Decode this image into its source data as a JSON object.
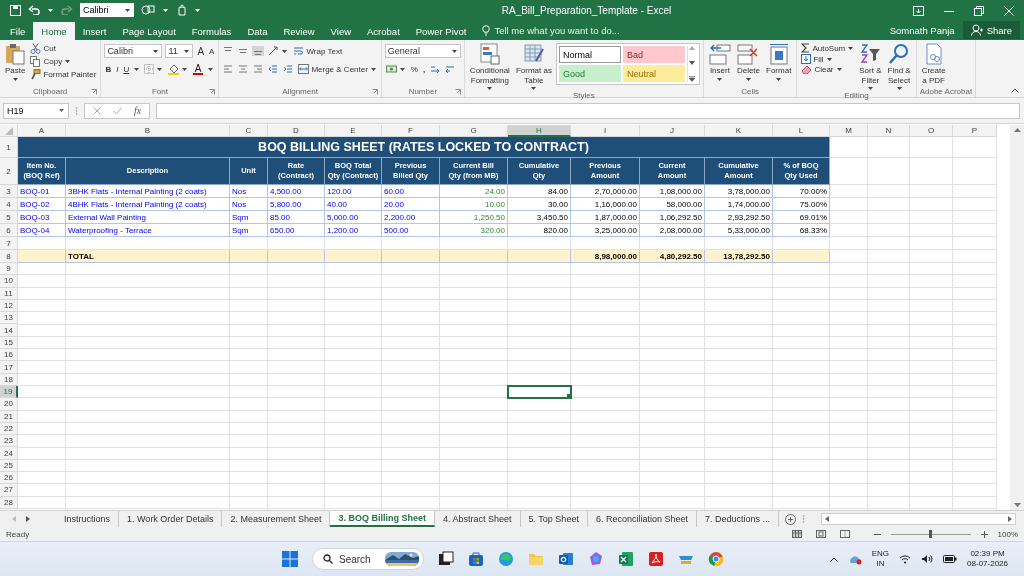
{
  "title_bar": {
    "font_box": "Calibri",
    "title": "RA_Bill_Preparation_Template - Excel"
  },
  "ribbon_tabs": [
    {
      "label": "File",
      "selected": false
    },
    {
      "label": "Home",
      "selected": true
    },
    {
      "label": "Insert",
      "selected": false
    },
    {
      "label": "Page Layout",
      "selected": false
    },
    {
      "label": "Formulas",
      "selected": false
    },
    {
      "label": "Data",
      "selected": false
    },
    {
      "label": "Review",
      "selected": false
    },
    {
      "label": "View",
      "selected": false
    },
    {
      "label": "Acrobat",
      "selected": false
    },
    {
      "label": "Power Pivot",
      "selected": false
    }
  ],
  "tell_me": "Tell me what you want to do...",
  "user": "Somnath Panja",
  "share": "Share",
  "ribbon": {
    "clipboard": {
      "paste": "Paste",
      "cut": "Cut",
      "copy": "Copy",
      "format_painter": "Format Painter",
      "label": "Clipboard"
    },
    "font": {
      "font_name": "Calibri",
      "font_size": "11",
      "grow": "A",
      "shrink": "A",
      "bold": "B",
      "italic": "I",
      "underline": "U",
      "font_color": "A",
      "label": "Font"
    },
    "alignment": {
      "vertical_align": [
        {
          "selected": false
        },
        {
          "selected": false
        },
        {
          "selected": true
        }
      ],
      "wrap_text": "Wrap Text",
      "merge_center": "Merge & Center",
      "label": "Alignment"
    },
    "number": {
      "format": "General",
      "percent": "%",
      "comma": ",",
      "label": "Number"
    },
    "styles": {
      "conditional_formatting": "Conditional\nFormatting",
      "format_as_table": "Format as\nTable",
      "cell_styles": [
        {
          "label": "Normal",
          "color": "#ffffff"
        },
        {
          "label": "Bad",
          "color": "#ffc7ce"
        },
        {
          "label": "Good",
          "color": "#c6efce"
        },
        {
          "label": "Neutral",
          "color": "#ffeb9c"
        }
      ],
      "label": "Styles"
    },
    "cells": {
      "insert": "Insert",
      "delete": "Delete",
      "format": "Format",
      "label": "Cells"
    },
    "editing": {
      "autosum": "AutoSum",
      "fill": "Fill",
      "clear": "Clear",
      "sort_filter": "Sort &\nFilter",
      "find_select": "Find &\nSelect",
      "label": "Editing"
    },
    "adobe": {
      "create_pdf": "Create\na PDF",
      "label": "Adobe Acrobat"
    }
  },
  "formula_bar": {
    "name_box": "H19",
    "function_label": "fx"
  },
  "sheet": {
    "columns": [
      {
        "label": "A",
        "selected": false
      },
      {
        "label": "B",
        "selected": false
      },
      {
        "label": "C",
        "selected": false
      },
      {
        "label": "D",
        "selected": false
      },
      {
        "label": "E",
        "selected": false
      },
      {
        "label": "F",
        "selected": false
      },
      {
        "label": "G",
        "selected": false
      },
      {
        "label": "H",
        "selected": true
      },
      {
        "label": "I",
        "selected": false
      },
      {
        "label": "J",
        "selected": false
      },
      {
        "label": "K",
        "selected": false
      },
      {
        "label": "L",
        "selected": false
      },
      {
        "label": "M",
        "selected": false
      },
      {
        "label": "N",
        "selected": false
      },
      {
        "label": "O",
        "selected": false
      },
      {
        "label": "P",
        "selected": false
      }
    ],
    "rows": [
      {
        "label": "1",
        "selected": false
      },
      {
        "label": "2",
        "selected": false
      },
      {
        "label": "3",
        "selected": false
      },
      {
        "label": "4",
        "selected": false
      },
      {
        "label": "5",
        "selected": false
      },
      {
        "label": "6",
        "selected": false
      },
      {
        "label": "7",
        "selected": false
      },
      {
        "label": "8",
        "selected": false
      },
      {
        "label": "9",
        "selected": false
      },
      {
        "label": "10",
        "selected": false
      },
      {
        "label": "11",
        "selected": false
      },
      {
        "label": "12",
        "selected": false
      },
      {
        "label": "13",
        "selected": false
      },
      {
        "label": "14",
        "selected": false
      },
      {
        "label": "15",
        "selected": false
      },
      {
        "label": "16",
        "selected": false
      },
      {
        "label": "17",
        "selected": false
      },
      {
        "label": "18",
        "selected": false
      },
      {
        "label": "19",
        "selected": true
      },
      {
        "label": "20",
        "selected": false
      },
      {
        "label": "21",
        "selected": false
      },
      {
        "label": "22",
        "selected": false
      },
      {
        "label": "23",
        "selected": false
      },
      {
        "label": "24",
        "selected": false
      },
      {
        "label": "25",
        "selected": false
      },
      {
        "label": "26",
        "selected": false
      },
      {
        "label": "27",
        "selected": false
      },
      {
        "label": "28",
        "selected": false
      }
    ],
    "title": "BOQ BILLING SHEET (RATES LOCKED TO CONTRACT)",
    "headers": [
      {
        "text": "Item No.\n(BOQ Ref)",
        "kind": "input"
      },
      {
        "text": "Description",
        "kind": "input"
      },
      {
        "text": "Unit",
        "kind": "input"
      },
      {
        "text": "Rate\n(Contract)",
        "kind": "input"
      },
      {
        "text": "BOQ Total\nQty (Contract)",
        "kind": "input"
      },
      {
        "text": "Previous\nBilled Qty",
        "kind": "input"
      },
      {
        "text": "Current Bill\nQty (from MB)",
        "kind": "measured"
      },
      {
        "text": "Cumulative\nQty",
        "kind": "computed"
      },
      {
        "text": "Previous\nAmount",
        "kind": "computed"
      },
      {
        "text": "Current\nAmount",
        "kind": "computed"
      },
      {
        "text": "Cumulative\nAmount",
        "kind": "computed"
      },
      {
        "text": "% of BOQ\nQty Used",
        "kind": "computed"
      }
    ],
    "items": [
      [
        "BOQ-01",
        "3BHK Flats - Internal Painting (2 coats)",
        "Nos",
        "4,500.00",
        "120.00",
        "60.00",
        "24.00",
        "84.00",
        "2,70,000.00",
        "1,08,000.00",
        "3,78,000.00",
        "70.00%"
      ],
      [
        "BOQ-02",
        "4BHK Flats - Internal Painting (2 coats)",
        "Nos",
        "5,800.00",
        "40.00",
        "20.00",
        "10.00",
        "30.00",
        "1,16,000.00",
        "58,000.00",
        "1,74,000.00",
        "75.00%"
      ],
      [
        "BOQ-03",
        "External Wall Painting",
        "Sqm",
        "85.00",
        "5,000.00",
        "2,200.00",
        "1,250.50",
        "3,450.50",
        "1,87,000.00",
        "1,06,292.50",
        "2,93,292.50",
        "69.01%"
      ],
      [
        "BOQ-04",
        "Waterproofing - Terrace",
        "Sqm",
        "650.00",
        "1,200.00",
        "500.00",
        "320.00",
        "820.00",
        "3,25,000.00",
        "2,08,000.00",
        "5,33,000.00",
        "68.33%"
      ]
    ],
    "total": {
      "label": "TOTAL",
      "amounts": [
        "8,98,000.00",
        "4,80,292.50",
        "13,78,292.50"
      ]
    }
  },
  "sheet_tabs": [
    {
      "label": "Instructions",
      "selected": false
    },
    {
      "label": "1. Work Order Details",
      "selected": false
    },
    {
      "label": "2. Measurement Sheet",
      "selected": false
    },
    {
      "label": "3. BOQ Billing Sheet",
      "selected": true
    },
    {
      "label": "4. Abstract Sheet",
      "selected": false
    },
    {
      "label": "5. Top Sheet",
      "selected": false
    },
    {
      "label": "6. Reconciliation Sheet",
      "selected": false
    },
    {
      "label": "7. Deductions ...",
      "selected": false
    }
  ],
  "status_bar": {
    "text": "Ready",
    "zoom": {
      "level": 0.5,
      "reading": "100%"
    }
  },
  "taskbar": {
    "search": "Search",
    "language": "ENG",
    "region": "IN",
    "time": "02:39 PM",
    "date": "08-07-2026"
  }
}
